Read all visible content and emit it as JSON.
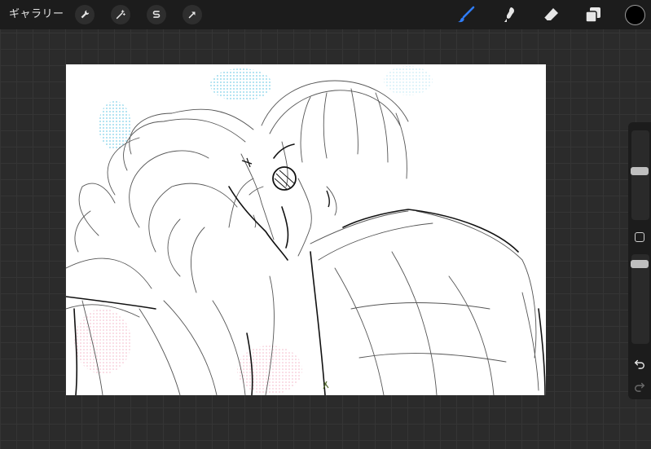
{
  "topbar": {
    "gallery_label": "ギャラリー",
    "left_tools": [
      {
        "name": "actions",
        "icon": "wrench-icon"
      },
      {
        "name": "adjustments",
        "icon": "magic-wand-icon"
      },
      {
        "name": "selection",
        "icon": "selection-s-icon"
      },
      {
        "name": "transform",
        "icon": "arrow-cursor-icon"
      }
    ],
    "right_tools": [
      {
        "name": "brush",
        "icon": "brush-icon",
        "active": true
      },
      {
        "name": "smudge",
        "icon": "smudge-icon"
      },
      {
        "name": "eraser",
        "icon": "eraser-icon"
      },
      {
        "name": "layers",
        "icon": "layers-icon"
      }
    ],
    "current_color": "#000000",
    "accent_color": "#2f7cf6"
  },
  "sidebar": {
    "brush_size_level": 0.55,
    "opacity_level": 0.05
  }
}
